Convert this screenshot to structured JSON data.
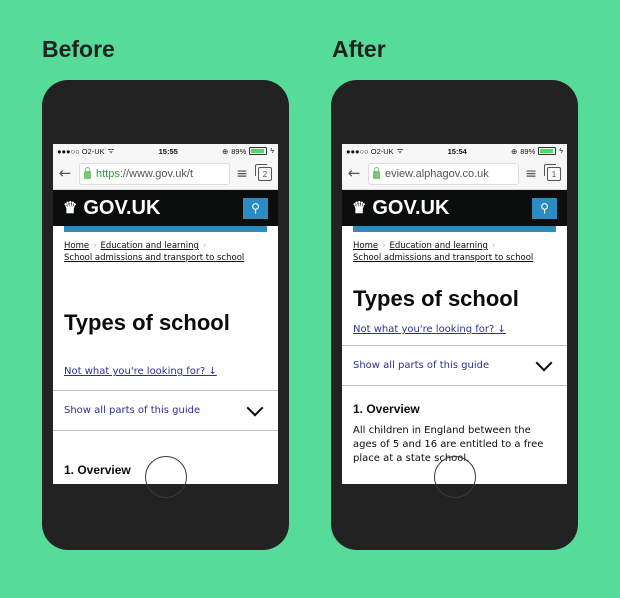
{
  "labels": {
    "before": "Before",
    "after": "After"
  },
  "before": {
    "status": {
      "carrier": "●●●○○ O2-UK",
      "wifi": "ᯤ",
      "time": "15:55",
      "battery": "89%"
    },
    "address": {
      "scheme": "https",
      "rest": "://www.gov.uk/t",
      "tabs_count": "2"
    },
    "brand": "GOV.UK",
    "breadcrumbs": [
      "Home",
      "Education and learning",
      "School admissions and transport to school"
    ],
    "title": "Types of school",
    "not_looking": "Not what you're looking for? ↓",
    "show_all": "Show all parts of this guide",
    "overview": "1. Overview"
  },
  "after": {
    "status": {
      "carrier": "●●●○○ O2-UK",
      "wifi": "ᯤ",
      "time": "15:54",
      "battery": "89%"
    },
    "address": {
      "scheme": "",
      "rest": "eview.alphagov.co.uk",
      "tabs_count": "1"
    },
    "brand": "GOV.UK",
    "breadcrumbs": [
      "Home",
      "Education and learning",
      "School admissions and transport to school"
    ],
    "title": "Types of school",
    "not_looking": "Not what you're looking for? ↓",
    "show_all": "Show all parts of this guide",
    "overview": "1. Overview",
    "paragraph": "All children in England between the ages of 5 and 16 are entitled to a free place at a state school."
  },
  "icons": {
    "back": "←",
    "menu": "≡",
    "crown": "♛",
    "search": "⚲",
    "rotation_lock": "⊕",
    "bolt": "ϟ"
  }
}
